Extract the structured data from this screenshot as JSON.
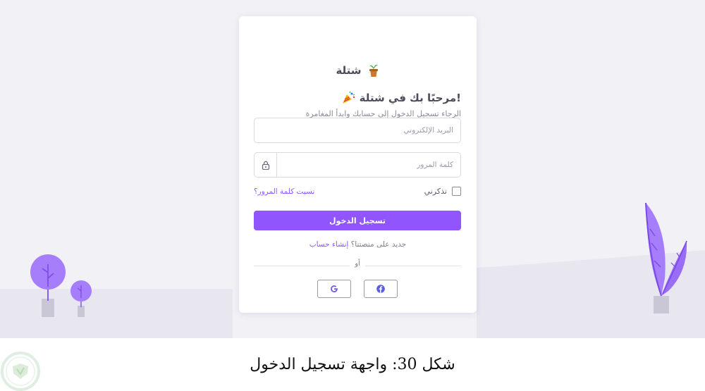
{
  "app": {
    "brand_name": "شتلة"
  },
  "login_card": {
    "welcome_title": "!مرحبًا بك في شتلة",
    "subtitle": "الرجاء تسجيل الدخول إلى حسابك وابدأ المغامرة",
    "email_placeholder": "البريد الإلكتروني",
    "password_placeholder": "كلمة المرور",
    "remember_label": "تذكرني",
    "forgot_password": "نسيت كلمة المرور؟",
    "login_button": "تسجيل الدخول",
    "signup_prompt": "جديد على منصتنا؟",
    "signup_link": "إنشاء حساب",
    "divider_text": "أو",
    "social": [
      {
        "name": "facebook",
        "icon": "facebook-icon"
      },
      {
        "name": "google",
        "icon": "google-icon"
      }
    ]
  },
  "caption": "شكل 30: واجهة تسجيل الدخول",
  "colors": {
    "primary": "#9055fd",
    "background": "#f1f1f6",
    "plant_light": "#a67dfb",
    "plant_dark": "#8a5cf0",
    "pot": "#c9c6d6"
  }
}
